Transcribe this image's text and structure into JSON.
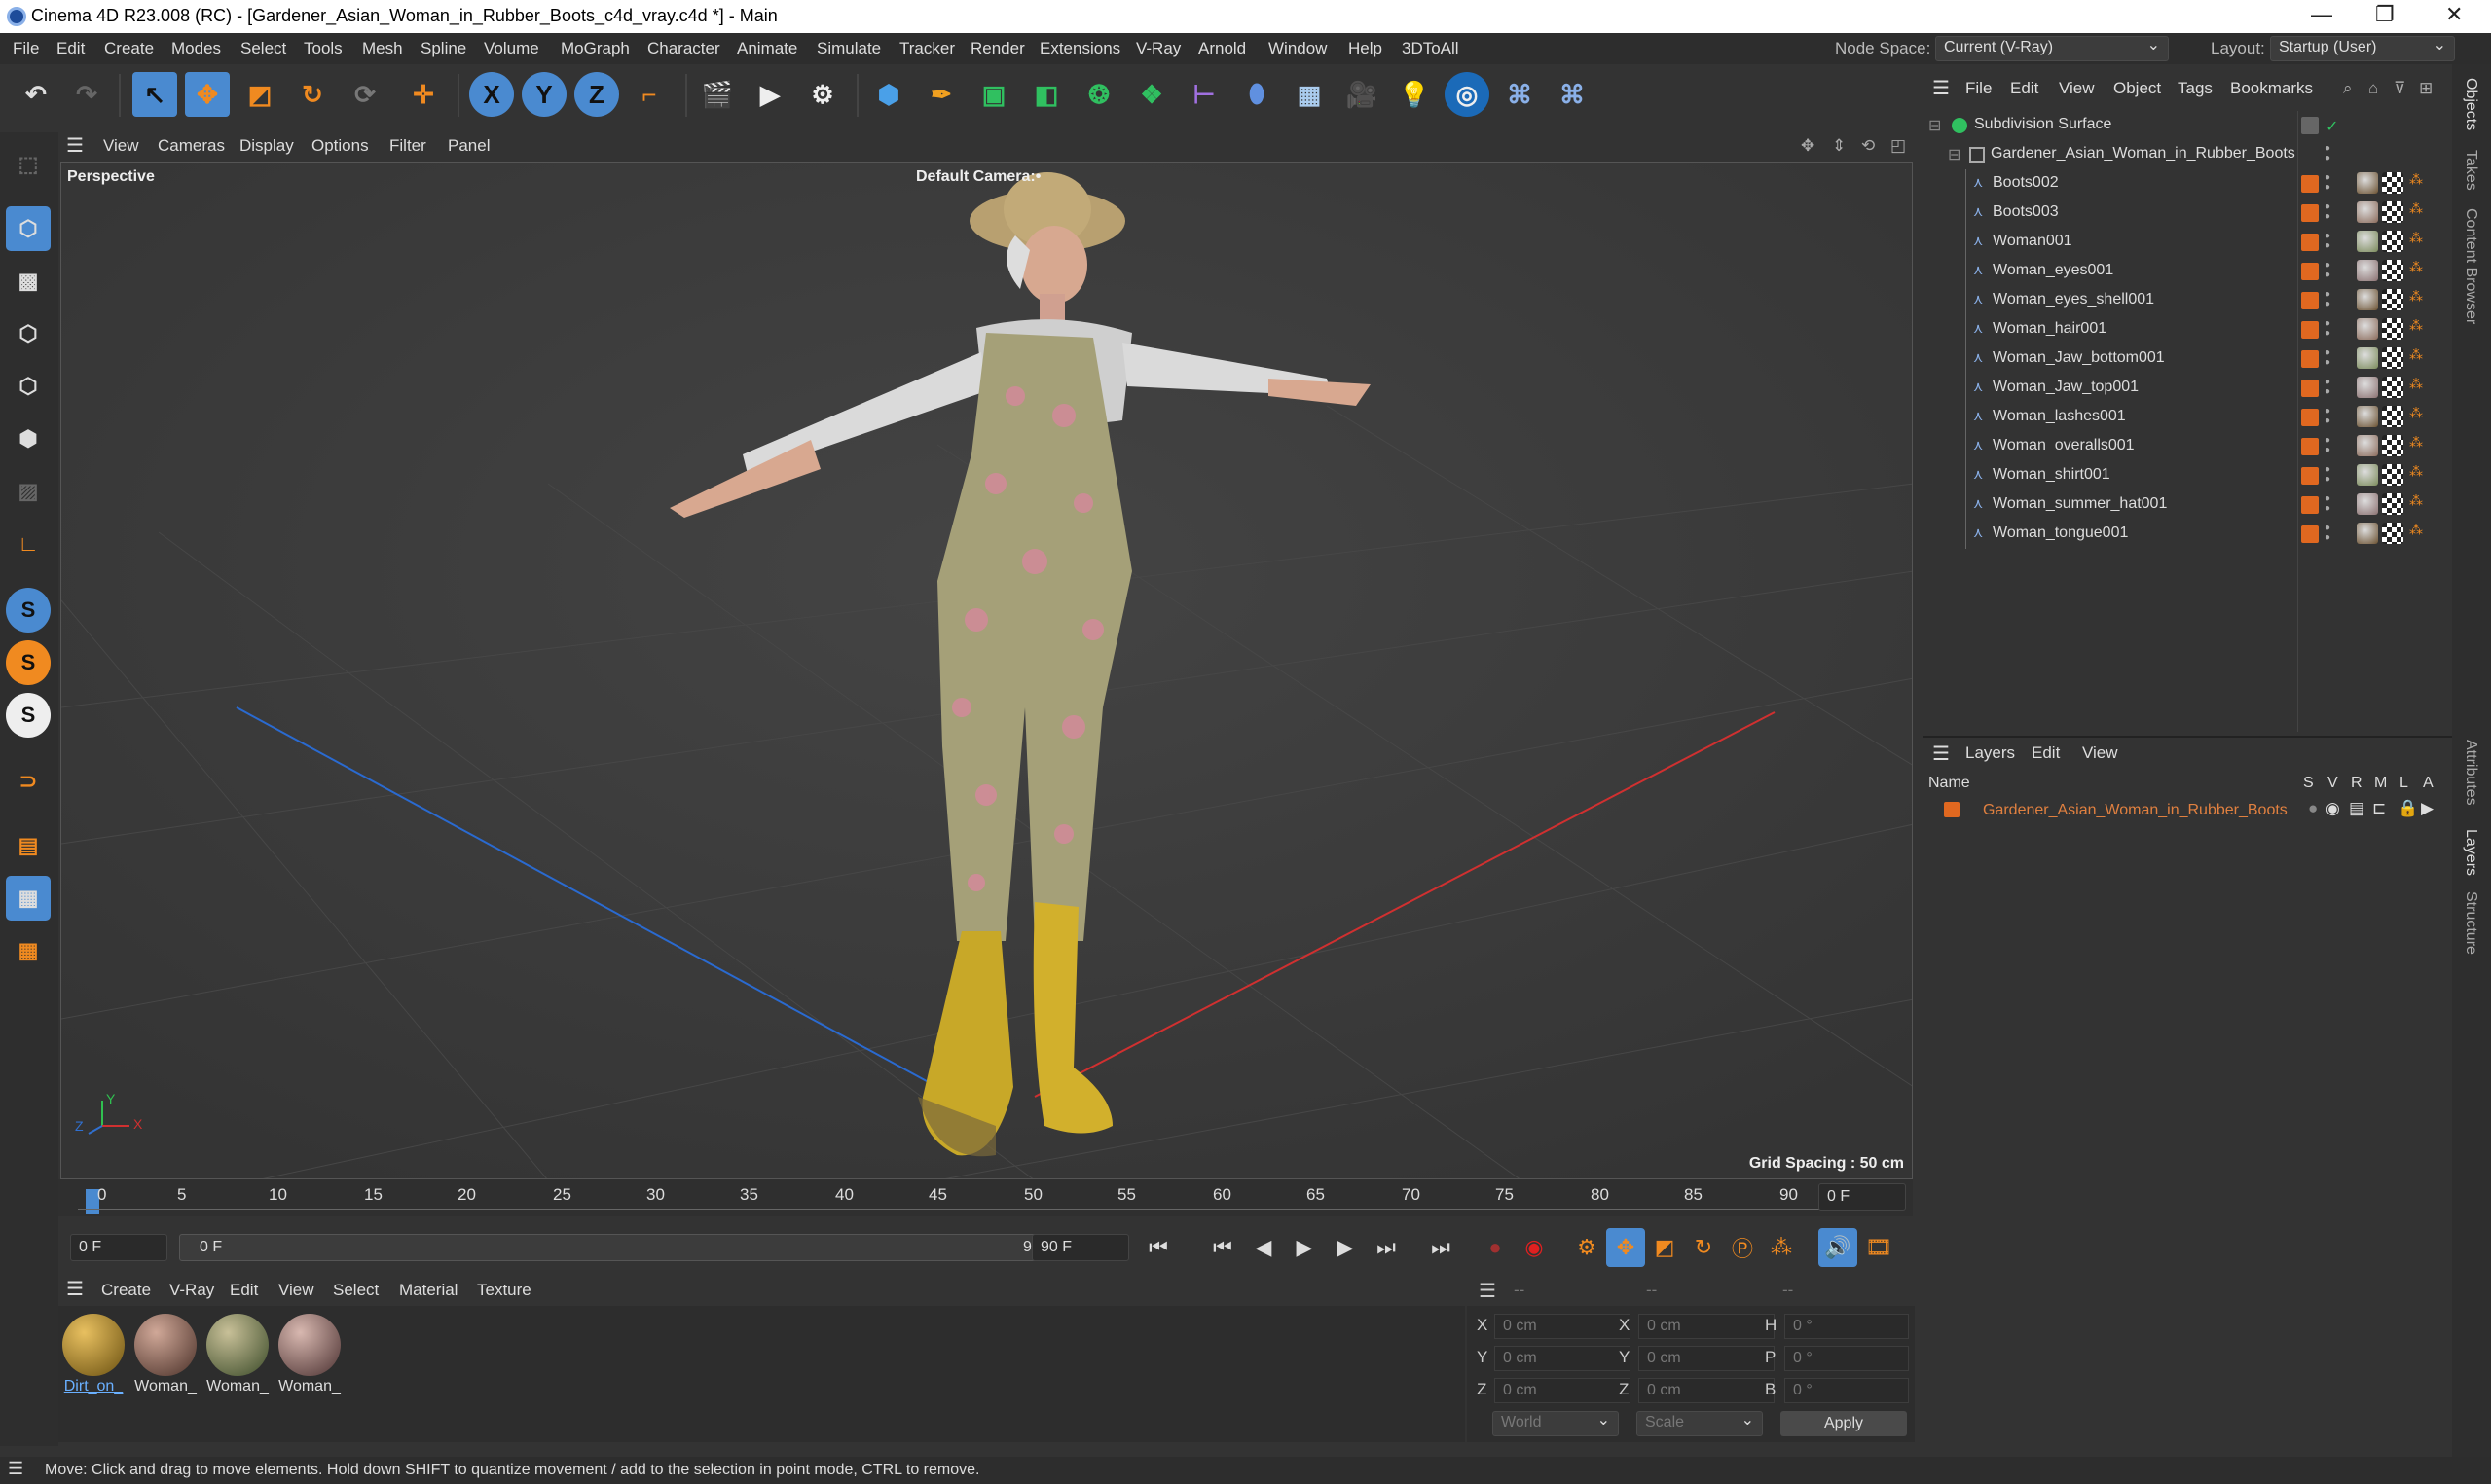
{
  "window": {
    "title": "Cinema 4D R23.008 (RC) - [Gardener_Asian_Woman_in_Rubber_Boots_c4d_vray.c4d *] - Main",
    "minimize": "—",
    "maximize": "❐",
    "close": "✕"
  },
  "menubar": {
    "items": [
      "File",
      "Edit",
      "Create",
      "Modes",
      "Select",
      "Tools",
      "Mesh",
      "Spline",
      "Volume",
      "MoGraph",
      "Character",
      "Animate",
      "Simulate",
      "Tracker",
      "Render",
      "Extensions",
      "V-Ray",
      "Arnold",
      "Window",
      "Help",
      "3DToAll"
    ],
    "node_space_label": "Node Space:",
    "node_space_value": "Current (V-Ray)",
    "layout_label": "Layout:",
    "layout_value": "Startup (User)"
  },
  "toolbar": {
    "icons": [
      "undo-icon",
      "redo-icon",
      "select-icon",
      "move-icon",
      "scale-icon",
      "rotate-icon",
      "live-select-icon",
      "add-icon",
      "x-axis-icon",
      "y-axis-icon",
      "z-axis-icon",
      "coordinate-system-icon",
      "render-region-icon",
      "render-view-icon",
      "render-settings-icon",
      "cube-icon",
      "pen-icon",
      "subdivision-icon",
      "extrude-icon",
      "cloner-icon",
      "array-icon",
      "symmetry-icon",
      "deformer-icon",
      "floor-icon",
      "camera-icon",
      "light-icon",
      "vray-icon",
      "python-icon",
      "python2-icon"
    ],
    "axis_x": "X",
    "axis_y": "Y",
    "axis_z": "Z"
  },
  "viewport": {
    "menu": [
      "View",
      "Cameras",
      "Display",
      "Options",
      "Filter",
      "Panel"
    ],
    "label": "Perspective",
    "camera": "Default Camera",
    "camera_icon": ":•",
    "grid_spacing": "Grid Spacing : 50 cm",
    "axis_x": "X",
    "axis_y": "Y",
    "axis_z": "Z"
  },
  "timeline": {
    "ticks": [
      "0",
      "5",
      "10",
      "15",
      "20",
      "25",
      "30",
      "35",
      "40",
      "45",
      "50",
      "55",
      "60",
      "65",
      "70",
      "75",
      "80",
      "85",
      "90"
    ],
    "current_frame": "0 F",
    "start_frame": "0 F",
    "range_start": "0 F",
    "range_end": "90 F",
    "end_frame": "90 F"
  },
  "material_panel": {
    "menu": [
      "Create",
      "V-Ray",
      "Edit",
      "View",
      "Select",
      "Material",
      "Texture"
    ],
    "materials": [
      {
        "name": "Dirt_on_",
        "color": "#b08a30"
      },
      {
        "name": "Woman_",
        "color": "#8a6a5a"
      },
      {
        "name": "Woman_",
        "color": "#7a8a5a"
      },
      {
        "name": "Woman_",
        "color": "#8a7070"
      }
    ]
  },
  "coordinates": {
    "header": [
      "--",
      "--",
      "--"
    ],
    "rows": [
      {
        "a": "X",
        "av": "0 cm",
        "b": "X",
        "bv": "0 cm",
        "c": "H",
        "cv": "0 °"
      },
      {
        "a": "Y",
        "av": "0 cm",
        "b": "Y",
        "bv": "0 cm",
        "c": "P",
        "cv": "0 °"
      },
      {
        "a": "Z",
        "av": "0 cm",
        "b": "Z",
        "bv": "0 cm",
        "c": "B",
        "cv": "0 °"
      }
    ],
    "mode1": "World",
    "mode2": "Scale",
    "apply": "Apply"
  },
  "status": "Move: Click and drag to move elements. Hold down SHIFT to quantize movement / add to the selection in point mode, CTRL to remove.",
  "object_manager": {
    "menu": [
      "File",
      "Edit",
      "View",
      "Object",
      "Tags",
      "Bookmarks"
    ],
    "root": "Subdivision Surface",
    "group": "Gardener_Asian_Woman_in_Rubber_Boots",
    "objects": [
      "Boots002",
      "Boots003",
      "Woman001",
      "Woman_eyes001",
      "Woman_eyes_shell001",
      "Woman_hair001",
      "Woman_Jaw_bottom001",
      "Woman_Jaw_top001",
      "Woman_lashes001",
      "Woman_overalls001",
      "Woman_shirt001",
      "Woman_summer_hat001",
      "Woman_tongue001"
    ]
  },
  "layer_manager": {
    "menu": [
      "Layers",
      "Edit",
      "View"
    ],
    "cols": {
      "name": "Name",
      "s": "S",
      "v": "V",
      "r": "R",
      "m": "M",
      "l": "L",
      "a": "A"
    },
    "layer": "Gardener_Asian_Woman_in_Rubber_Boots",
    "layer_color": "#e06820"
  },
  "side_tabs": [
    "Objects",
    "Takes",
    "Content Browser",
    "Attributes",
    "Layers",
    "Structure"
  ],
  "colors": {
    "accent": "#e06820",
    "highlight": "#4a8ad0"
  }
}
